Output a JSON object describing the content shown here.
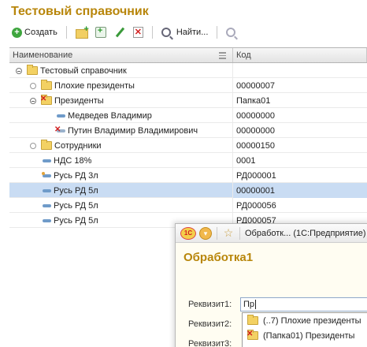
{
  "page_title": "Тестовый справочник",
  "toolbar": {
    "create_label": "Создать",
    "find_label": "Найти..."
  },
  "columns": {
    "name": "Наименование",
    "code": "Код"
  },
  "rows": [
    {
      "name": "Тестовый справочник",
      "code": "",
      "type": "folder",
      "level": 0,
      "expander": "open"
    },
    {
      "name": "Плохие президенты",
      "code": "00000007",
      "type": "folder",
      "level": 1,
      "expander": "closed"
    },
    {
      "name": "Президенты",
      "code": "Папка01",
      "type": "folder-deleted",
      "level": 1,
      "expander": "open"
    },
    {
      "name": "Медведев Владимир",
      "code": "00000000",
      "type": "item",
      "level": 2
    },
    {
      "name": "Путин Владимир Владимирович",
      "code": "00000000",
      "type": "item-deleted",
      "level": 2
    },
    {
      "name": "Сотрудники",
      "code": "00000150",
      "type": "folder",
      "level": 1,
      "expander": "closed"
    },
    {
      "name": "НДС 18%",
      "code": "0001",
      "type": "item",
      "level": 1
    },
    {
      "name": "Русь РД 3л",
      "code": "РД000001",
      "type": "item-marked",
      "level": 1
    },
    {
      "name": "Русь РД 5л",
      "code": "00000001",
      "type": "item",
      "level": 1,
      "selected": true
    },
    {
      "name": "Русь РД 5л",
      "code": "РД000056",
      "type": "item",
      "level": 1
    },
    {
      "name": "Русь РД 5л",
      "code": "РД000057",
      "type": "item",
      "level": 1
    }
  ],
  "dialog": {
    "window_title": "Обработк... (1С:Предприятие)",
    "header": "Обработка1",
    "label1": "Реквизит1:",
    "label2": "Реквизит2:",
    "label3": "Реквизит3:",
    "field1_value": "Пр",
    "dropdown": [
      {
        "label": "(..7) Плохие президенты",
        "type": "folder"
      },
      {
        "label": "(Папка01) Президенты",
        "type": "folder-deleted"
      }
    ]
  },
  "colors": {
    "title": "#b8860b",
    "selection": "#c9dcf3",
    "folder": "#f3d163"
  }
}
